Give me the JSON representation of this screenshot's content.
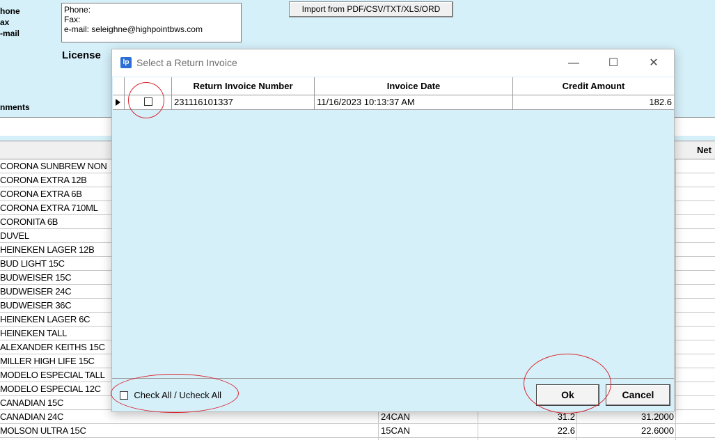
{
  "background_form": {
    "labels": {
      "phone": "hone",
      "fax": "ax",
      "email": "-mail",
      "comments": "nments"
    },
    "contact_lines": [
      "Phone:",
      "Fax:",
      "e-mail: seleighne@highpointbws.com"
    ],
    "import_button": "Import from PDF/CSV/TXT/XLS/ORD",
    "license_label": "License",
    "net_column_header": "Net",
    "products": [
      {
        "name": "CORONA SUNBREW NON",
        "pack": "",
        "v1": "",
        "v2": ""
      },
      {
        "name": "CORONA EXTRA 12B",
        "pack": "",
        "v1": "",
        "v2": ""
      },
      {
        "name": "CORONA EXTRA 6B",
        "pack": "",
        "v1": "",
        "v2": ""
      },
      {
        "name": "CORONA EXTRA 710ML",
        "pack": "",
        "v1": "",
        "v2": ""
      },
      {
        "name": "CORONITA 6B",
        "pack": "",
        "v1": "",
        "v2": ""
      },
      {
        "name": "DUVEL",
        "pack": "",
        "v1": "",
        "v2": ""
      },
      {
        "name": "HEINEKEN LAGER 12B",
        "pack": "",
        "v1": "",
        "v2": ""
      },
      {
        "name": "BUD LIGHT 15C",
        "pack": "",
        "v1": "",
        "v2": ""
      },
      {
        "name": "BUDWEISER 15C",
        "pack": "",
        "v1": "",
        "v2": ""
      },
      {
        "name": "BUDWEISER 24C",
        "pack": "",
        "v1": "",
        "v2": ""
      },
      {
        "name": "BUDWEISER 36C",
        "pack": "",
        "v1": "",
        "v2": ""
      },
      {
        "name": "HEINEKEN LAGER 6C",
        "pack": "",
        "v1": "",
        "v2": ""
      },
      {
        "name": "HEINEKEN TALL",
        "pack": "",
        "v1": "",
        "v2": ""
      },
      {
        "name": "ALEXANDER KEITHS 15C",
        "pack": "",
        "v1": "",
        "v2": ""
      },
      {
        "name": "MILLER HIGH LIFE 15C",
        "pack": "",
        "v1": "",
        "v2": ""
      },
      {
        "name": "MODELO ESPECIAL TALL",
        "pack": "",
        "v1": "",
        "v2": ""
      },
      {
        "name": "MODELO ESPECIAL 12C",
        "pack": "",
        "v1": "",
        "v2": ""
      },
      {
        "name": "CANADIAN 15C",
        "pack": "",
        "v1": "",
        "v2": ""
      },
      {
        "name": "CANADIAN 24C",
        "pack": "24CAN",
        "v1": "31.2",
        "v2": "31.2000"
      },
      {
        "name": "MOLSON ULTRA 15C",
        "pack": "15CAN",
        "v1": "22.6",
        "v2": "22.6000"
      }
    ]
  },
  "dialog": {
    "title": "Select a Return Invoice",
    "app_icon": "lp",
    "controls": {
      "minimize": "—",
      "maximize": "☐",
      "close": "✕"
    },
    "columns": [
      "Return Invoice Number",
      "Invoice Date",
      "Credit Amount"
    ],
    "rows": [
      {
        "checked": false,
        "invoice_number": "231116101337",
        "invoice_date": "11/16/2023 10:13:37 AM",
        "credit_amount": "182.6"
      }
    ],
    "check_all_label": "Check All / Ucheck All",
    "ok_label": "Ok",
    "cancel_label": "Cancel",
    "annotation_color": "#d9232d"
  }
}
